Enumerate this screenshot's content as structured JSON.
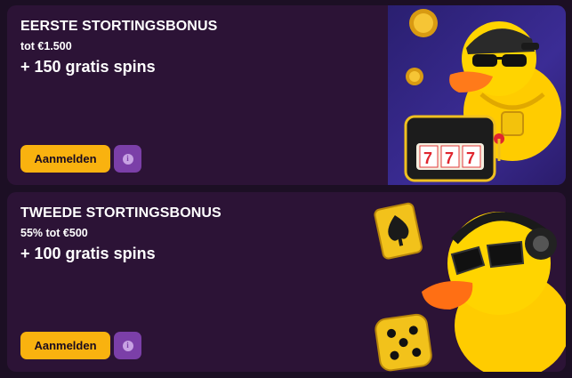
{
  "offers": [
    {
      "title": "EERSTE STORTINGSBONUS",
      "amount": "tot €1.500",
      "spins": "+ 150 gratis spins",
      "button_label": "Aanmelden",
      "info_icon": "info-icon"
    },
    {
      "title": "TWEEDE STORTINGSBONUS",
      "amount": "55% tot €500",
      "spins": "+ 100 gratis spins",
      "button_label": "Aanmelden",
      "info_icon": "info-icon"
    }
  ],
  "colors": {
    "card_bg": "#2c1336",
    "button": "#f9b20f",
    "info_button": "#7b3fa8",
    "duck": "#ffd400"
  }
}
